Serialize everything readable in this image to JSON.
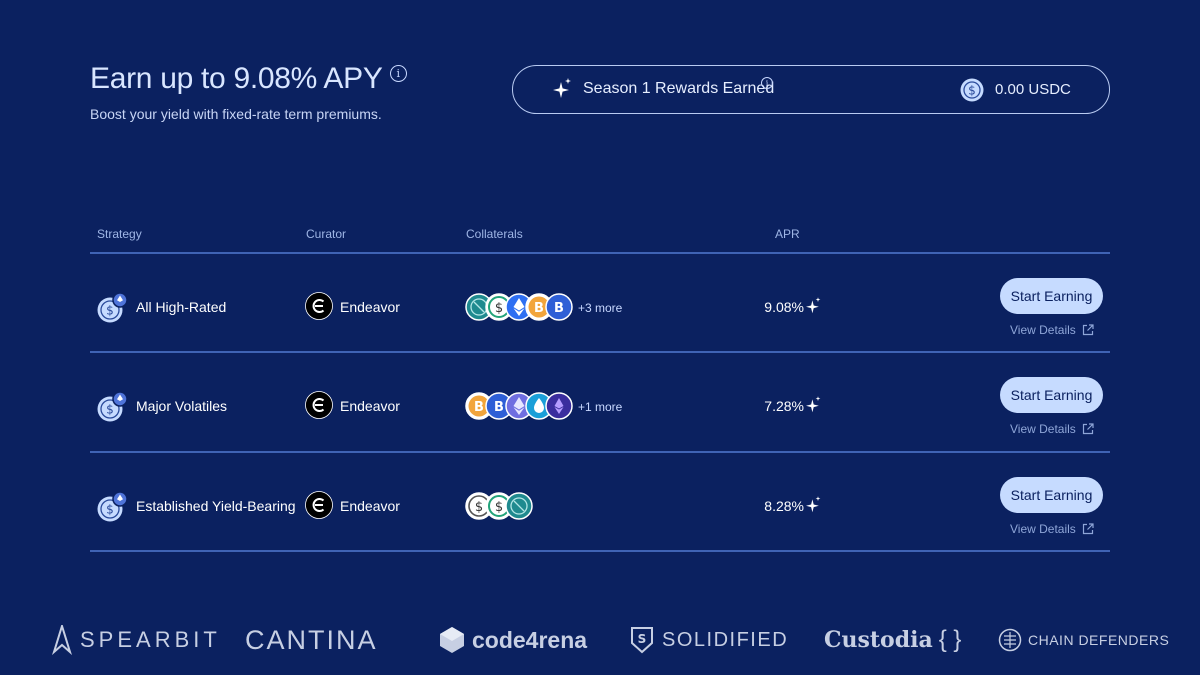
{
  "header": {
    "title": "Earn up to 9.08% APY",
    "subtitle": "Boost your yield with fixed-rate term premiums."
  },
  "rewards": {
    "label": "Season 1 Rewards Earned",
    "value": "0.00 USDC"
  },
  "table": {
    "columns": [
      "Strategy",
      "Curator",
      "Collaterals",
      "APR"
    ],
    "rows": [
      {
        "strategy": "All High-Rated",
        "curator": "Endeavor",
        "collaterals": [
          "usdc-teal",
          "usdc-green",
          "eth-blue",
          "btc-orange",
          "btc-blue"
        ],
        "more": "+3 more",
        "apr": "9.08%",
        "action": "Start Earning",
        "details": "View Details"
      },
      {
        "strategy": "Major Volatiles",
        "curator": "Endeavor",
        "collaterals": [
          "btc-orange",
          "btc-blue",
          "eth-purple",
          "eth-cyan",
          "eth-violet"
        ],
        "more": "+1 more",
        "apr": "7.28%",
        "action": "Start Earning",
        "details": "View Details"
      },
      {
        "strategy": "Established Yield-Bearing",
        "curator": "Endeavor",
        "collaterals": [
          "usd-gray",
          "usd-green",
          "usdc-teal"
        ],
        "more": "",
        "apr": "8.28%",
        "action": "Start Earning",
        "details": "View Details"
      }
    ]
  },
  "partners": [
    "SPEARBIT",
    "CANTINA",
    "code4rena",
    "SOLIDIFIED",
    "Custodia",
    "CHAIN DEFENDERS"
  ],
  "colors": {
    "background": "#0b2160",
    "divider": "#3f63b5",
    "button": "#c6dbff",
    "muted_text": "#9fb6e6"
  }
}
